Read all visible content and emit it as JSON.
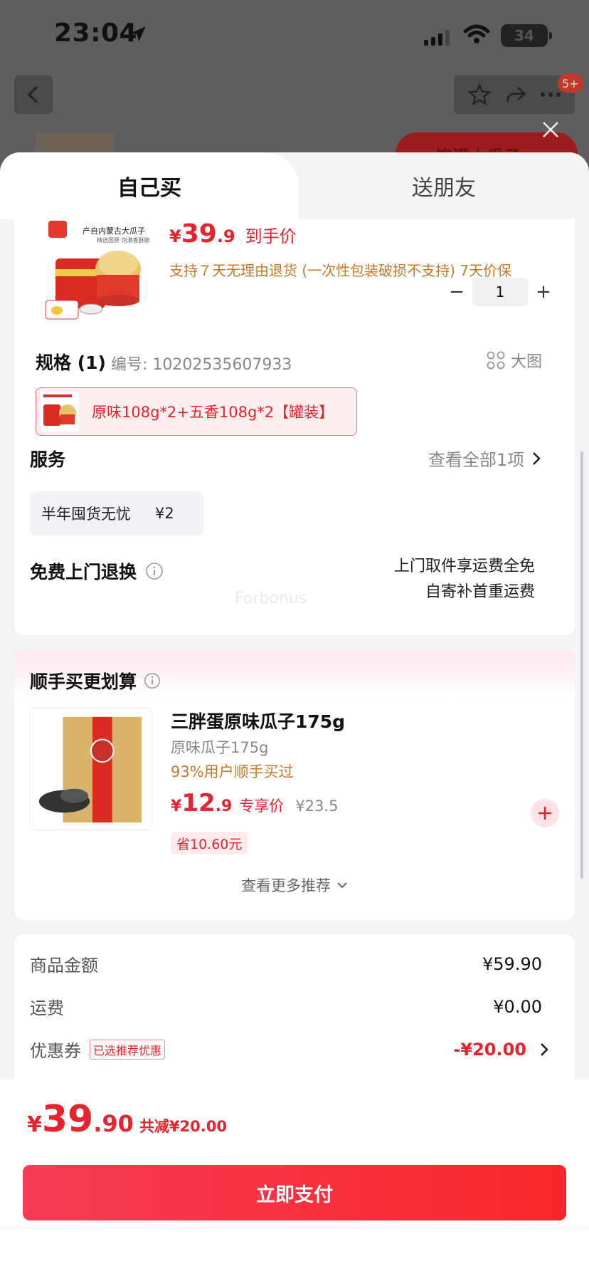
{
  "status": {
    "time": "23:04",
    "battery": "34"
  },
  "background": {
    "badge": "5+",
    "red_button": "饱满大瓜子"
  },
  "tabs": [
    {
      "label": "自己买"
    },
    {
      "label": "送朋友"
    }
  ],
  "product": {
    "image_caption": "产自内蒙古大瓜子",
    "price": {
      "symbol": "¥",
      "integer": "39",
      "decimal": ".9",
      "tag": "到手价"
    },
    "policy": "支持７天无理由退货 (一次性包装破损不支持)   7天价保",
    "quantity": "1",
    "minus": "−",
    "plus": "+"
  },
  "spec": {
    "title": "规格 (1)",
    "number": "编号: 10202535607933",
    "big_view": "大图",
    "selected": "原味108g*2+五香108g*2【罐装】"
  },
  "service": {
    "title": "服务",
    "view_all": "查看全部1项",
    "chip_name": "半年囤货无忧",
    "chip_price": "¥2"
  },
  "returns": {
    "title": "免费上门退换",
    "line1": "上门取件享运费全免",
    "line2": "自寄补首重运费"
  },
  "watermark": "Forbonus",
  "addon": {
    "title": "顺手买更划算",
    "name": "三胖蛋原味瓜子175g",
    "spec": "原味瓜子175g",
    "popularity": "93%用户顺手买过",
    "price": {
      "symbol": "¥",
      "integer": "12",
      "decimal": ".9",
      "tag": "专享价",
      "original": "¥23.5"
    },
    "save": "省10.60元",
    "more": "查看更多推荐"
  },
  "summary": {
    "goods_label": "商品金额",
    "goods_value": "¥59.90",
    "shipping_label": "运费",
    "shipping_value": "¥0.00",
    "coupon_label": "优惠券",
    "coupon_badge": "已选推荐优惠",
    "coupon_value": "-¥20.00"
  },
  "total": {
    "symbol": "¥",
    "integer": "39",
    "decimal": ".90",
    "saved": "共减¥20.00"
  },
  "pay_button": "立即支付",
  "colors": {
    "accent": "#e8232d",
    "orange_text": "#c47a2a",
    "pay_gradient_start": "#f63c56",
    "pay_gradient_end": "#f8262a"
  }
}
